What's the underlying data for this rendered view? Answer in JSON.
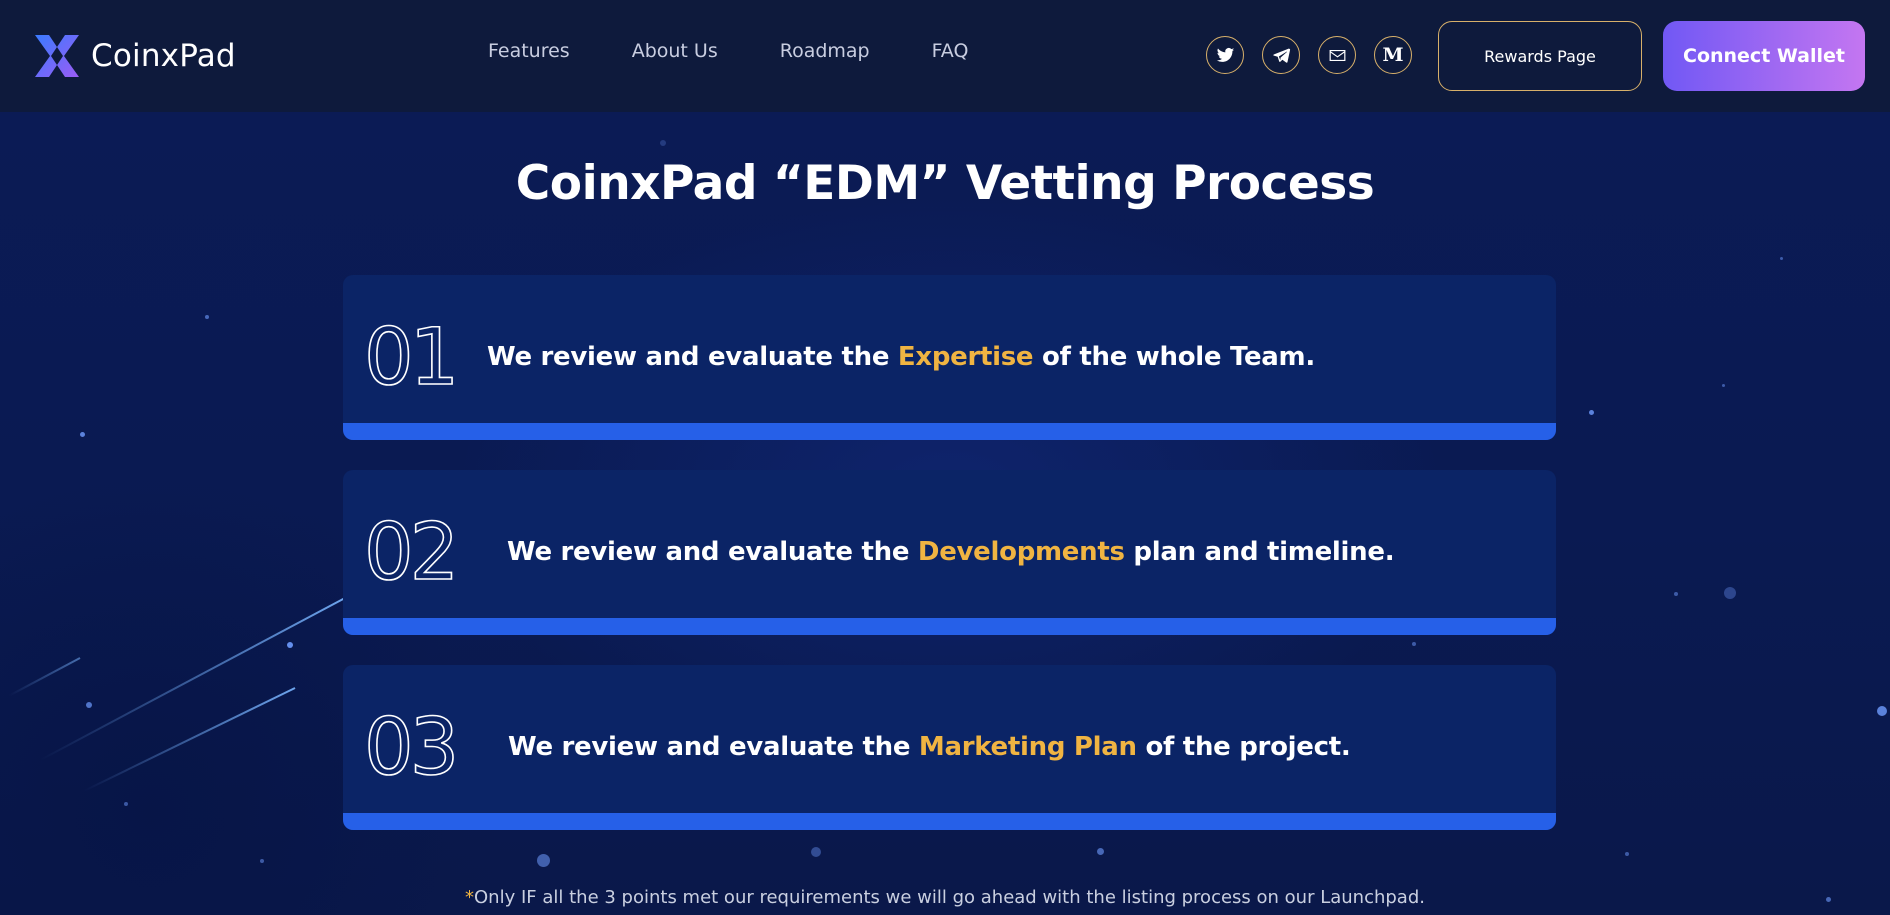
{
  "header": {
    "brand": "CoinxPad",
    "nav": [
      "Features",
      "About Us",
      "Roadmap",
      "FAQ"
    ],
    "social_icons": [
      "twitter-icon",
      "telegram-icon",
      "mail-icon",
      "medium-icon"
    ],
    "medium_glyph": "M",
    "rewards_label": "Rewards Page",
    "connect_label": "Connect Wallet"
  },
  "main": {
    "title": "CoinxPad “EDM” Vetting Process",
    "steps": [
      {
        "number": "01",
        "before": "We review and evaluate the ",
        "highlight": "Expertise",
        "after": " of the whole Team."
      },
      {
        "number": "02",
        "before": "We review and evaluate the ",
        "highlight": "Developments",
        "after": " plan and timeline."
      },
      {
        "number": "03",
        "before": "We review and evaluate the ",
        "highlight": "Marketing Plan",
        "after": " of the project."
      }
    ],
    "footnote_mark": "*",
    "footnote": "Only IF all the 3 points met our requirements we will go ahead with the listing process on our Launchpad."
  },
  "colors": {
    "header_bg": "#0e1a3c",
    "page_bg": "#0a1a4e",
    "card_bg": "#0b2466",
    "card_bar": "#2660e8",
    "highlight": "#f0b442",
    "border_gold": "#d7b06a",
    "button_gradient_start": "#7158f4",
    "button_gradient_end": "#c476f1"
  }
}
